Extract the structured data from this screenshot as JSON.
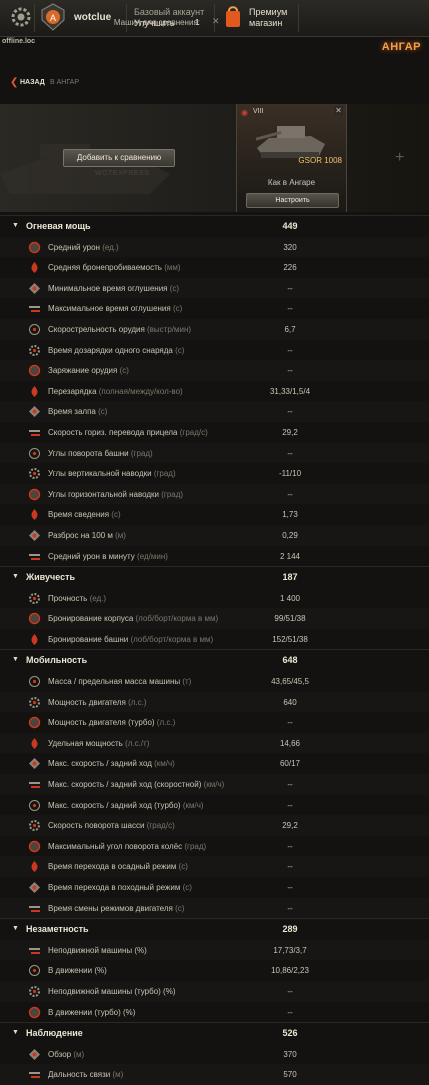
{
  "topbar": {
    "username": "wotclue",
    "account_line1": "Базовый аккаунт",
    "account_line2": "Улучшить",
    "premium_line1": "Премиум",
    "premium_line2": "магазин"
  },
  "server": "offline.loc",
  "screen_title": "АНГАР",
  "nav": {
    "back_label": "НАЗАД",
    "back_path": "В АНГАР"
  },
  "compare": {
    "count_label": "Машин для сравнения:",
    "count": "1",
    "add_button": "Добавить к сравнению",
    "watermark": "WOTEXPRESS"
  },
  "vehicle": {
    "tier": "VIII",
    "name": "GSOR 1008",
    "state": "Как в Ангаре",
    "configure": "Настроить"
  },
  "colors": {
    "accent": "#f0a24a",
    "icon_red": "#c8391f",
    "text": "#cac4b5"
  },
  "sections": [
    {
      "title": "Огневая мощь",
      "value": "449",
      "rows": [
        {
          "icon": "damage-icon",
          "label": "Средний урон",
          "unit": "(ед.)",
          "value": "320"
        },
        {
          "icon": "penetration-icon",
          "label": "Средняя бронепробиваемость",
          "unit": "(мм)",
          "value": "226"
        },
        {
          "icon": "stun-min-icon",
          "label": "Минимальное время оглушения",
          "unit": "(с)",
          "value": "--"
        },
        {
          "icon": "stun-max-icon",
          "label": "Максимальное время оглушения",
          "unit": "(с)",
          "value": "--"
        },
        {
          "icon": "rate-of-fire-icon",
          "label": "Скорострельность орудия",
          "unit": "(выстр/мин)",
          "value": "6,7"
        },
        {
          "icon": "reload-shell-icon",
          "label": "Время дозарядки одного снаряда",
          "unit": "(с)",
          "value": "--"
        },
        {
          "icon": "loading-icon",
          "label": "Заряжание орудия",
          "unit": "(с)",
          "value": "--"
        },
        {
          "icon": "autoloader-icon",
          "label": "Перезарядка",
          "unit": "(полная/между/кол-во)",
          "value": "31,33/1,5/4"
        },
        {
          "icon": "salvo-icon",
          "label": "Время залпа",
          "unit": "(с)",
          "value": "--"
        },
        {
          "icon": "aim-speed-icon",
          "label": "Скорость гориз. перевода прицела",
          "unit": "(град/с)",
          "value": "29,2"
        },
        {
          "icon": "turret-angle-icon",
          "label": "Углы поворота башни",
          "unit": "(град)",
          "value": "--"
        },
        {
          "icon": "vertical-angle-icon",
          "label": "Углы вертикальной наводки",
          "unit": "(град)",
          "value": "-11/10"
        },
        {
          "icon": "horizontal-angle-icon",
          "label": "Углы горизонтальной наводки",
          "unit": "(град)",
          "value": "--"
        },
        {
          "icon": "aim-time-icon",
          "label": "Время сведения",
          "unit": "(с)",
          "value": "1,73"
        },
        {
          "icon": "dispersion-icon",
          "label": "Разброс на 100 м",
          "unit": "(м)",
          "value": "0,29"
        },
        {
          "icon": "dpm-icon",
          "label": "Средний урон в минуту",
          "unit": "(ед/мин)",
          "value": "2 144"
        }
      ]
    },
    {
      "title": "Живучесть",
      "value": "187",
      "rows": [
        {
          "icon": "hp-icon",
          "label": "Прочность",
          "unit": "(ед.)",
          "value": "1 400"
        },
        {
          "icon": "hull-armor-icon",
          "label": "Бронирование корпуса",
          "unit": "(лоб/борт/корма в мм)",
          "value": "99/51/38"
        },
        {
          "icon": "turret-armor-icon",
          "label": "Бронирование башни",
          "unit": "(лоб/борт/корма в мм)",
          "value": "152/51/38"
        }
      ]
    },
    {
      "title": "Мобильность",
      "value": "648",
      "rows": [
        {
          "icon": "weight-icon",
          "label": "Масса / предельная масса машины",
          "unit": "(т)",
          "value": "43,65/45,5"
        },
        {
          "icon": "engine-power-icon",
          "label": "Мощность двигателя",
          "unit": "(л.с.)",
          "value": "640"
        },
        {
          "icon": "engine-turbo-icon",
          "label": "Мощность двигателя (турбо)",
          "unit": "(л.с.)",
          "value": "--"
        },
        {
          "icon": "specific-power-icon",
          "label": "Удельная мощность",
          "unit": "(л.с./т)",
          "value": "14,66"
        },
        {
          "icon": "speed-icon",
          "label": "Макс. скорость / задний ход",
          "unit": "(км/ч)",
          "value": "60/17"
        },
        {
          "icon": "speed-fast-icon",
          "label": "Макс. скорость / задний ход (скоростной)",
          "unit": "(км/ч)",
          "value": "--"
        },
        {
          "icon": "speed-turbo-icon",
          "label": "Макс. скорость / задний ход (турбо)",
          "unit": "(км/ч)",
          "value": "--"
        },
        {
          "icon": "traverse-icon",
          "label": "Скорость поворота шасси",
          "unit": "(град/с)",
          "value": "29,2"
        },
        {
          "icon": "wheel-angle-icon",
          "label": "Максимальный угол поворота колёс",
          "unit": "(град)",
          "value": "--"
        },
        {
          "icon": "siege-mode-icon",
          "label": "Время перехода в осадный режим",
          "unit": " (с)",
          "value": "--"
        },
        {
          "icon": "travel-mode-icon",
          "label": "Время перехода в походный режим",
          "unit": " (с)",
          "value": "--"
        },
        {
          "icon": "engine-mode-icon",
          "label": "Время смены режимов двигателя",
          "unit": "(с)",
          "value": "--"
        }
      ]
    },
    {
      "title": "Незаметность",
      "value": "289",
      "rows": [
        {
          "icon": "camo-still-icon",
          "label": "Неподвижной машины (%)",
          "unit": "",
          "value": "17,73/3,7"
        },
        {
          "icon": "camo-moving-icon",
          "label": "В движении (%)",
          "unit": "",
          "value": "10,86/2,23"
        },
        {
          "icon": "camo-still-turbo-icon",
          "label": "Неподвижной машины (турбо) (%)",
          "unit": "",
          "value": "--"
        },
        {
          "icon": "camo-moving-turbo-icon",
          "label": "В движении (турбо) (%)",
          "unit": "",
          "value": "--"
        }
      ]
    },
    {
      "title": "Наблюдение",
      "value": "526",
      "rows": [
        {
          "icon": "view-range-icon",
          "label": "Обзор",
          "unit": "(м)",
          "value": "370"
        },
        {
          "icon": "radio-range-icon",
          "label": "Дальность связи",
          "unit": "(м)",
          "value": "570"
        }
      ]
    }
  ]
}
